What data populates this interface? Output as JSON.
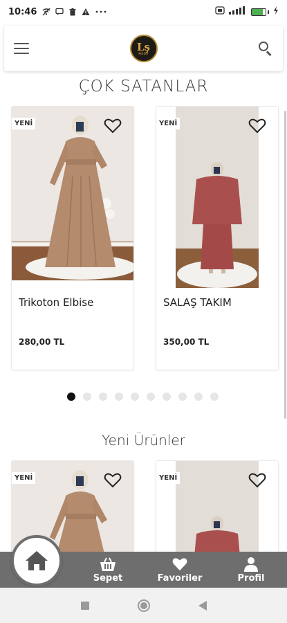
{
  "status_bar": {
    "time": "10:46",
    "icons_left": [
      "wifi-off-icon",
      "message-icon",
      "trash-icon",
      "warning-icon",
      "more-icon"
    ],
    "battery_level": 0.8
  },
  "header": {
    "logo_text": "Lş",
    "logo_sub": "MODA"
  },
  "sections": {
    "best_sellers": "ÇOK SATANLAR",
    "new_products": "Yeni Ürünler"
  },
  "best_sellers": [
    {
      "badge": "YENİ",
      "name": "Trikoton Elbise",
      "price": "280,00 TL"
    },
    {
      "badge": "YENİ",
      "name": "SALAŞ TAKIM",
      "price": "350,00 TL"
    }
  ],
  "new_products": [
    {
      "badge": "YENİ"
    },
    {
      "badge": "YENİ"
    }
  ],
  "carousel": {
    "count": 10,
    "active": 0
  },
  "bottom_nav": {
    "home_label": "home-icon",
    "items": [
      {
        "label": "Sepet",
        "icon": "basket-icon"
      },
      {
        "label": "Favoriler",
        "icon": "heart-icon"
      },
      {
        "label": "Profil",
        "icon": "person-icon"
      }
    ]
  },
  "colors": {
    "nav_bg": "#6e6e6e",
    "dress_beige": "#b48b6d",
    "suit_rose": "#a9504e"
  }
}
